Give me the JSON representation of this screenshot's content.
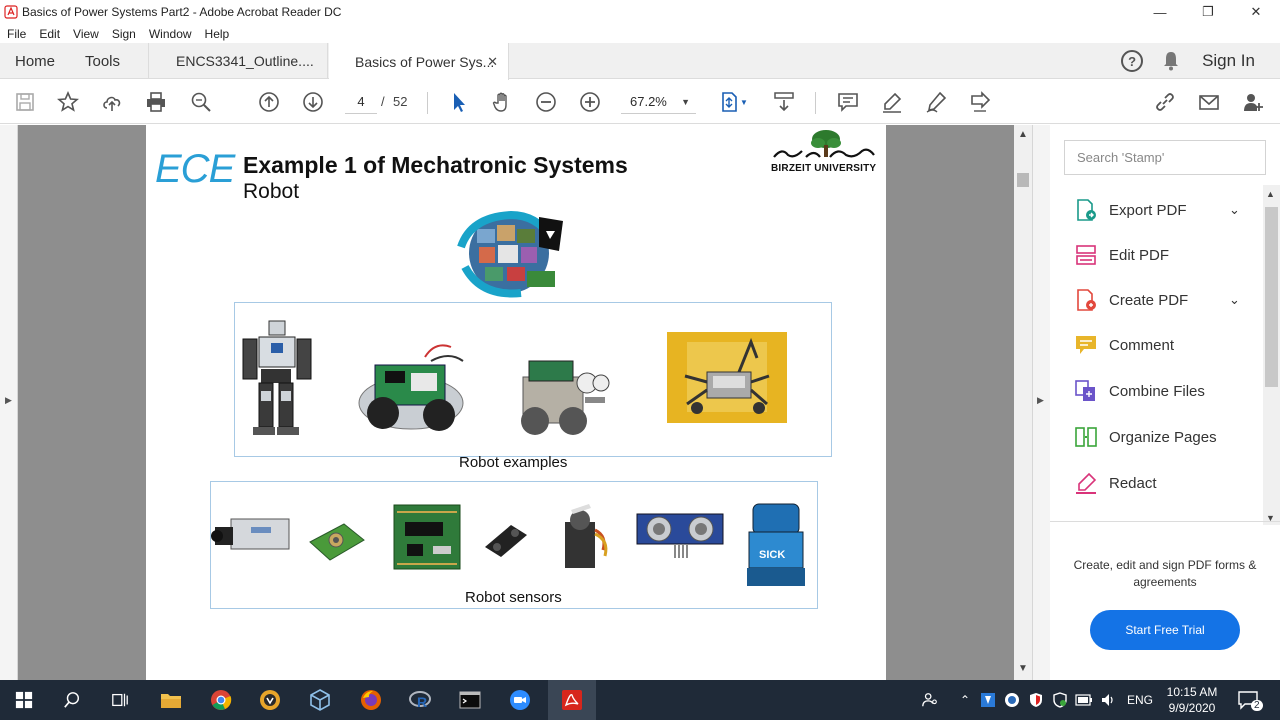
{
  "window": {
    "title": "Basics of Power Systems Part2 - Adobe Acrobat Reader DC",
    "minimize": "—",
    "maximize": "❐",
    "close": "✕"
  },
  "menu": [
    "File",
    "Edit",
    "View",
    "Sign",
    "Window",
    "Help"
  ],
  "tabs": {
    "home": "Home",
    "tools": "Tools",
    "doc1": "ENCS3341_Outline....",
    "doc2": "Basics of Power Sys...",
    "close": "✕",
    "signin": "Sign In"
  },
  "toolbar": {
    "current_page": "4",
    "page_separator": "/",
    "total_pages": "52",
    "zoom": "67.2%"
  },
  "slide": {
    "logo": "ECE",
    "title": "Example 1 of Mechatronic Systems",
    "subtitle": "Robot",
    "university": "BIRZEIT UNIVERSITY",
    "robots_caption": "Robot examples",
    "sensors_caption": "Robot sensors"
  },
  "side_panel": {
    "search_placeholder": "Search 'Stamp'",
    "tools": [
      {
        "label": "Export PDF",
        "icon": "export-pdf-icon",
        "color": "#1a9a8a",
        "expandable": true
      },
      {
        "label": "Edit PDF",
        "icon": "edit-pdf-icon",
        "color": "#d9347a",
        "expandable": false
      },
      {
        "label": "Create PDF",
        "icon": "create-pdf-icon",
        "color": "#e2483d",
        "expandable": true
      },
      {
        "label": "Comment",
        "icon": "comment-icon",
        "color": "#e8b52a",
        "expandable": false
      },
      {
        "label": "Combine Files",
        "icon": "combine-files-icon",
        "color": "#6b54c9",
        "expandable": false
      },
      {
        "label": "Organize Pages",
        "icon": "organize-pages-icon",
        "color": "#3aa53a",
        "expandable": false
      },
      {
        "label": "Redact",
        "icon": "redact-icon",
        "color": "#d9347a",
        "expandable": false
      }
    ],
    "promo": "Create, edit and sign PDF forms & agreements",
    "trial_button": "Start Free Trial"
  },
  "taskbar": {
    "language": "ENG",
    "time": "10:15 AM",
    "date": "9/9/2020",
    "notifications": "2"
  }
}
